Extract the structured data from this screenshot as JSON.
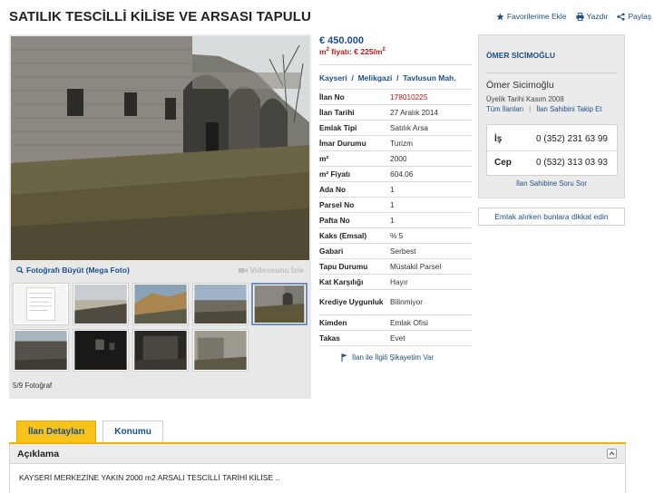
{
  "listing": {
    "title": "SATILIK TESCİLLİ KİLİSE VE ARSASI TAPULU"
  },
  "actions": {
    "favorite": "Favorilerime Ekle",
    "print": "Yazdır",
    "share": "Paylaş"
  },
  "photos": {
    "enlarge": "Fotoğrafı Büyüt (Mega Foto)",
    "video": "Videosunu İzle",
    "count": "5/9 Fotoğraf",
    "current_index": 5,
    "total": 9
  },
  "price": {
    "total": "€ 450.000",
    "per_m2_label": "m",
    "per_m2_sup": "2",
    "per_m2_rest": " fiyatı: € 225/m",
    "per_m2_sup2": "2"
  },
  "location": {
    "city": "Kayseri",
    "sep1": "/",
    "district": "Melikgazi",
    "sep2": "/",
    "neighborhood": "Tavlusun Mah."
  },
  "attributes": [
    {
      "key": "İlan No",
      "value": "178010225"
    },
    {
      "key": "İlan Tarihi",
      "value": "27 Aralık 2014"
    },
    {
      "key": "Emlak Tipi",
      "value": "Satılık Arsa"
    },
    {
      "key": "İmar Durumu",
      "value": "Turizm"
    },
    {
      "key": "m²",
      "value": "2000"
    },
    {
      "key": "m² Fiyatı",
      "value": "604.06"
    },
    {
      "key": "Ada No",
      "value": "1"
    },
    {
      "key": "Parsel No",
      "value": "1"
    },
    {
      "key": "Pafta No",
      "value": "1"
    },
    {
      "key": "Kaks (Emsal)",
      "value": "% 5"
    },
    {
      "key": "Gabari",
      "value": "Serbest"
    },
    {
      "key": "Tapu Durumu",
      "value": "Müstakil Parsel"
    },
    {
      "key": "Kat Karşılığı",
      "value": "Hayır"
    },
    {
      "key": "Krediye Uygunluk",
      "value": "Bilinmiyor"
    },
    {
      "key": "Kimden",
      "value": "Emlak Ofisi"
    },
    {
      "key": "Takas",
      "value": "Evet"
    }
  ],
  "complain": "İlan ile İlgili Şikayetim Var",
  "owner": {
    "heading": "ÖMER SİCİMOĞLU",
    "name": "Ömer Sicimoğlu",
    "member_since": "Üyelik Tarihi  Kasım 2008",
    "all_listings": "Tüm İlanları",
    "divider": "|",
    "follow": "İlan Sahibini Takip Et",
    "phones": [
      {
        "label": "İş",
        "number": "0 (352) 231 63 99"
      },
      {
        "label": "Cep",
        "number": "0 (532) 313 03 93"
      }
    ],
    "ask": "İlan Sahibine Soru Sor"
  },
  "warning": "Emlak alırken bunlara dikkat edin",
  "tabs": [
    {
      "label": "İlan Detayları",
      "active": true
    },
    {
      "label": "Konumu",
      "active": false
    }
  ],
  "description": {
    "heading": "Açıklama",
    "text": "KAYSERİ MERKEZİNE YAKIN 2000 m2 ARSALI TESCİLLİ TARİHİ KİLİSE .."
  },
  "colors": {
    "link": "#1b4f8c",
    "price_red": "#b81818",
    "tab_active": "#f7c21a"
  }
}
